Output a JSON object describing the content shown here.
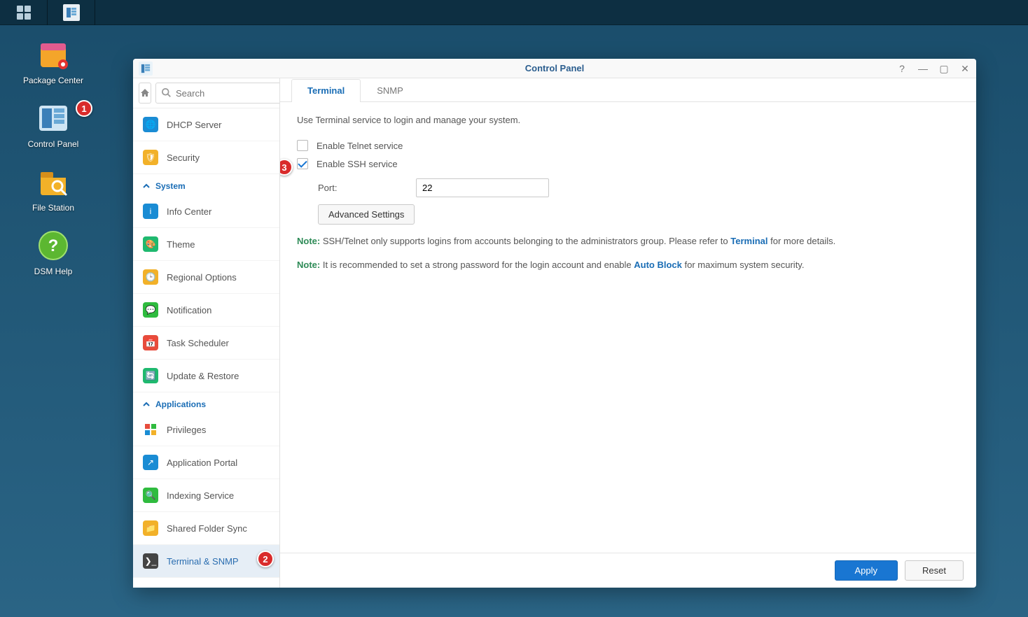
{
  "desktop": {
    "items": [
      {
        "label": "Package Center"
      },
      {
        "label": "Control Panel"
      },
      {
        "label": "File Station"
      },
      {
        "label": "DSM Help"
      }
    ]
  },
  "annotations": {
    "badge1": "1",
    "badge2": "2",
    "badge3": "3"
  },
  "window": {
    "title": "Control Panel",
    "search_placeholder": "Search"
  },
  "sidebar": {
    "groups": [
      {
        "name": "System",
        "items": [
          {
            "label": "DHCP Server"
          },
          {
            "label": "Security"
          },
          {
            "label": "Info Center"
          },
          {
            "label": "Theme"
          },
          {
            "label": "Regional Options"
          },
          {
            "label": "Notification"
          },
          {
            "label": "Task Scheduler"
          },
          {
            "label": "Update & Restore"
          }
        ]
      },
      {
        "name": "Applications",
        "items": [
          {
            "label": "Privileges"
          },
          {
            "label": "Application Portal"
          },
          {
            "label": "Indexing Service"
          },
          {
            "label": "Shared Folder Sync"
          },
          {
            "label": "Terminal & SNMP"
          }
        ]
      }
    ]
  },
  "tabs": [
    {
      "label": "Terminal"
    },
    {
      "label": "SNMP"
    }
  ],
  "terminal_pane": {
    "desc": "Use Terminal service to login and manage your system.",
    "telnet_label": "Enable Telnet service",
    "ssh_label": "Enable SSH service",
    "port_label": "Port:",
    "port_value": "22",
    "adv_btn": "Advanced Settings",
    "note1_label": "Note:",
    "note1_text_a": " SSH/Telnet only supports logins from accounts belonging to the administrators group. Please refer to ",
    "note1_link": "Terminal",
    "note1_text_b": " for more details.",
    "note2_label": "Note:",
    "note2_text_a": " It is recommended to set a strong password for the login account and enable ",
    "note2_link": "Auto Block",
    "note2_text_b": " for maximum system security."
  },
  "footer": {
    "apply": "Apply",
    "reset": "Reset"
  }
}
